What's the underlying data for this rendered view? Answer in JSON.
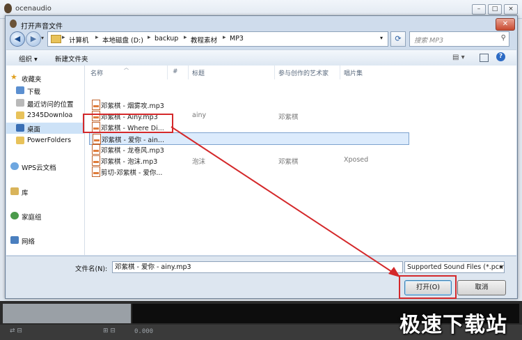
{
  "app": {
    "title": "ocenaudio"
  },
  "dialog": {
    "title": "打开声音文件"
  },
  "address": {
    "breadcrumbs": [
      "计算机",
      "本地磁盘 (D:)",
      "backup",
      "教程素材",
      "MP3"
    ]
  },
  "search": {
    "placeholder": "搜索 MP3"
  },
  "toolbar": {
    "organize_label": "组织 ▾",
    "new_folder_label": "新建文件夹"
  },
  "nav": {
    "favorites_label": "收藏夹",
    "items": [
      "下载",
      "最近访问的位置",
      "2345Downloa",
      "桌面",
      "PowerFolders"
    ],
    "wps_label": "WPS云文档",
    "library_label": "库",
    "homegroup_label": "家庭组",
    "network_label": "网络"
  },
  "columns": {
    "name": "名称",
    "track": "#",
    "title": "标题",
    "artist": "参与创作的艺术家",
    "album": "唱片集"
  },
  "files": [
    {
      "name": "邓紫棋 - 烟雾攻.mp3",
      "title": "",
      "artist": "",
      "album": ""
    },
    {
      "name": "邓紫棋 - Ainy.mp3",
      "title": "ainy",
      "artist": "邓紫棋",
      "album": ""
    },
    {
      "name": "邓紫棋 - Where Di...",
      "title": "",
      "artist": "",
      "album": ""
    },
    {
      "name": "邓紫棋 - 爱你 - ain...",
      "title": "",
      "artist": "",
      "album": ""
    },
    {
      "name": "邓紫棋 - 龙卷风.mp3",
      "title": "",
      "artist": "",
      "album": ""
    },
    {
      "name": "邓紫棋 - 泡沫.mp3",
      "title": "泡沫",
      "artist": "邓紫棋",
      "album": "Xposed"
    },
    {
      "name": "剪切-邓紫棋 - 爱你...",
      "title": "",
      "artist": "",
      "album": ""
    }
  ],
  "form": {
    "filename_label": "文件名(N):",
    "filename_value": "邓紫棋 - 爱你 - ainy.mp3",
    "filetype_value": "Supported Sound Files (*.pcm",
    "open_label": "打开(O)",
    "cancel_label": "取消"
  },
  "player": {
    "time": "0.000"
  },
  "watermark": "极速下载站",
  "colors": {
    "annotation": "#d4282a",
    "selection": "#dcebfc"
  }
}
